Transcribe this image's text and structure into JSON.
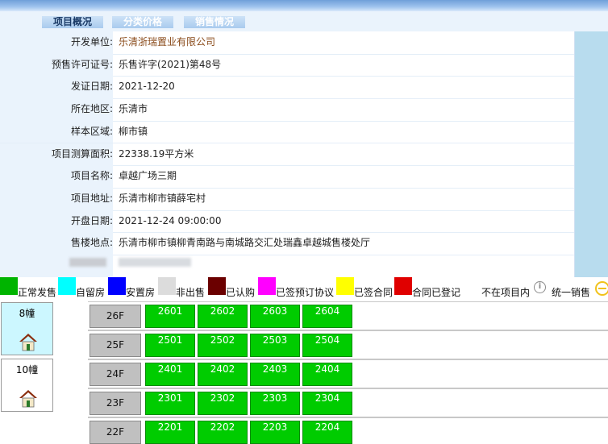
{
  "tabs": [
    {
      "label": "项目概况"
    },
    {
      "label": "分类价格"
    },
    {
      "label": "销售情况"
    }
  ],
  "project_info": [
    {
      "label": "开发单位:",
      "value": "乐清浙瑞置业有限公司"
    },
    {
      "label": "预售许可证号:",
      "value": "乐售许字(2021)第48号"
    },
    {
      "label": "发证日期:",
      "value": "2021-12-20"
    },
    {
      "label": "所在地区:",
      "value": "乐清市"
    },
    {
      "label": "样本区域:",
      "value": "柳市镇"
    },
    {
      "label": "项目测算面积:",
      "value": "22338.19平方米"
    },
    {
      "label": "项目名称:",
      "value": "卓越广场三期"
    },
    {
      "label": "项目地址:",
      "value": "乐清市柳市镇薛宅村"
    },
    {
      "label": "开盘日期:",
      "value": "2021-12-24 09:00:00"
    },
    {
      "label": "售楼地点:",
      "value": "乐清市柳市镇柳青南路与南城路交汇处瑞鑫卓越城售楼处厅"
    }
  ],
  "legend": [
    {
      "label": "正常发售",
      "color": "#00b400"
    },
    {
      "label": "自留房",
      "color": "#00ffff"
    },
    {
      "label": "安置房",
      "color": "#0000ff"
    },
    {
      "label": "非出售",
      "color": "#dcdcdc"
    },
    {
      "label": "已认购",
      "color": "#6b0000"
    },
    {
      "label": "已签预订协议",
      "color": "#ff00ff"
    },
    {
      "label": "已签合同",
      "color": "#ffff00"
    },
    {
      "label": "合同已登记",
      "color": "#e00000"
    },
    {
      "label": "不在项目内",
      "color": "#ffffff"
    },
    {
      "label": "统一销售",
      "color": "#8a8a8a"
    }
  ],
  "info_glyph": "i",
  "buildings": [
    {
      "name": "8幢",
      "selected": true
    },
    {
      "name": "10幢",
      "selected": false
    }
  ],
  "floors": [
    {
      "floor": "26F",
      "units": [
        "2601",
        "2602",
        "2603",
        "2604"
      ]
    },
    {
      "floor": "25F",
      "units": [
        "2501",
        "2502",
        "2503",
        "2504"
      ]
    },
    {
      "floor": "24F",
      "units": [
        "2401",
        "2402",
        "2403",
        "2404"
      ]
    },
    {
      "floor": "23F",
      "units": [
        "2301",
        "2302",
        "2303",
        "2304"
      ]
    },
    {
      "floor": "22F",
      "units": [
        "2201",
        "2202",
        "2203",
        "2204"
      ]
    }
  ]
}
